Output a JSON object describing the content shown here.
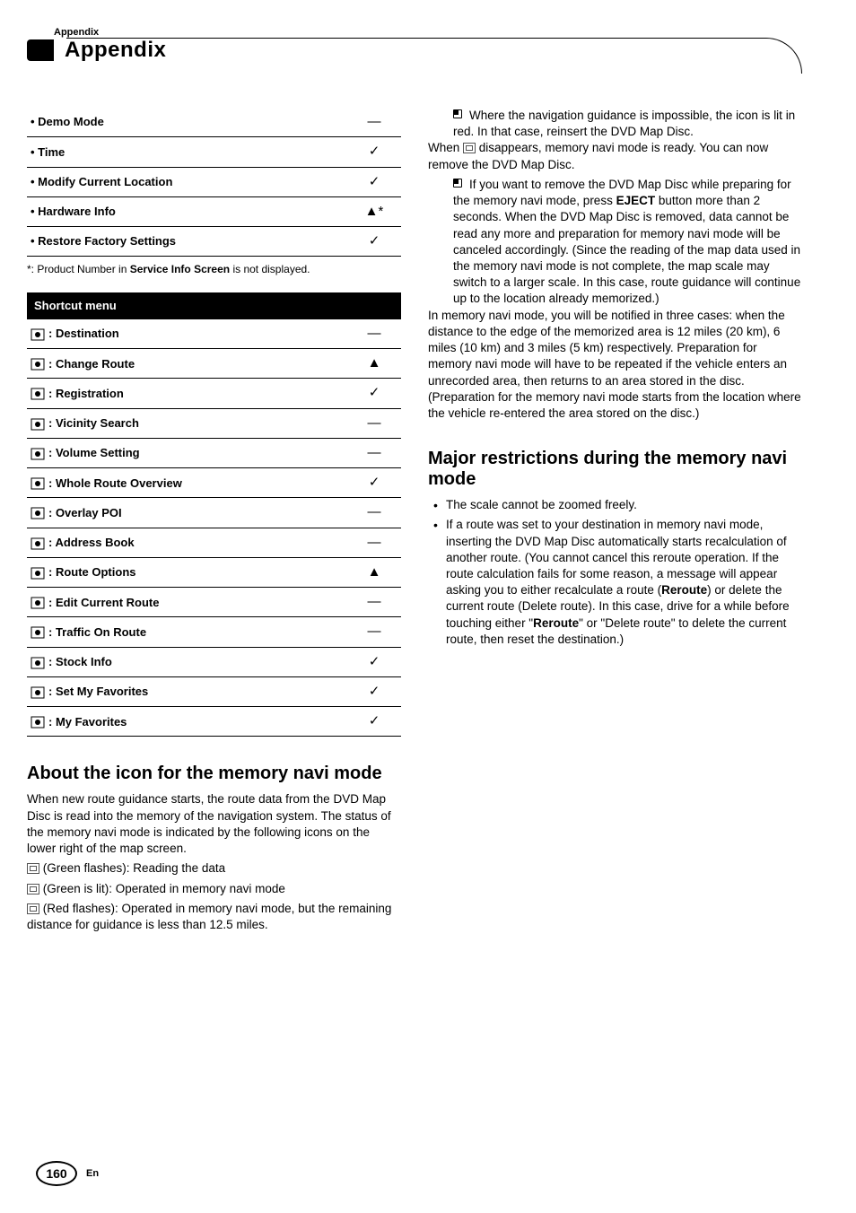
{
  "header": {
    "section_label": "Appendix",
    "chapter_title": "Appendix"
  },
  "table1": {
    "rows": [
      {
        "label": "• Demo Mode",
        "mark": "—"
      },
      {
        "label": "• Time",
        "mark": "✓"
      },
      {
        "label": "• Modify Current Location",
        "mark": "✓"
      },
      {
        "label": "• Hardware Info",
        "mark": "▲*"
      },
      {
        "label": "• Restore Factory Settings",
        "mark": "✓"
      }
    ],
    "footnote_a": "*: Product Number in ",
    "footnote_b": "Service Info Screen",
    "footnote_c": " is not displayed."
  },
  "shortcut": {
    "header": "Shortcut menu",
    "rows": [
      {
        "icon": "destination-icon",
        "label": ": Destination",
        "mark": "—"
      },
      {
        "icon": "change-route-icon",
        "label": ": Change Route",
        "mark": "▲"
      },
      {
        "icon": "registration-icon",
        "label": ": Registration",
        "mark": "✓"
      },
      {
        "icon": "vicinity-search-icon",
        "label": ": Vicinity Search",
        "mark": "—"
      },
      {
        "icon": "volume-setting-icon",
        "label": ": Volume Setting",
        "mark": "—"
      },
      {
        "icon": "whole-route-icon",
        "label": ": Whole Route Overview",
        "mark": "✓"
      },
      {
        "icon": "overlay-poi-icon",
        "label": ": Overlay POI",
        "mark": "—"
      },
      {
        "icon": "address-book-icon",
        "label": ": Address Book",
        "mark": "—"
      },
      {
        "icon": "route-options-icon",
        "label": ": Route Options",
        "mark": "▲"
      },
      {
        "icon": "edit-route-icon",
        "label": ": Edit Current Route",
        "mark": "—"
      },
      {
        "icon": "traffic-route-icon",
        "label": ": Traffic On Route",
        "mark": "—"
      },
      {
        "icon": "stock-info-icon",
        "label": ": Stock Info",
        "mark": "✓"
      },
      {
        "icon": "set-favorites-icon",
        "label": ": Set My Favorites",
        "mark": "✓"
      },
      {
        "icon": "my-favorites-icon",
        "label": ": My Favorites",
        "mark": "✓"
      }
    ]
  },
  "left_section": {
    "heading": "About the icon for the memory navi mode",
    "p1": "When new route guidance starts, the route data from the DVD Map Disc is read into the memory of the navigation system. The status of the memory navi mode is indicated by the following icons on the lower right of the map screen.",
    "l1": " (Green flashes): Reading the data",
    "l2": " (Green is lit): Operated in memory navi mode",
    "l3": " (Red flashes): Operated in memory navi mode, but the remaining distance for guidance is less than 12.5 miles."
  },
  "right": {
    "note1": "Where the navigation guidance is impossible, the icon is lit in red. In that case, reinsert the DVD Map Disc.",
    "p_when_a": "When ",
    "p_when_b": " disappears, memory navi mode is ready. You can now remove the DVD Map Disc.",
    "note2_a": "If you want to remove the DVD Map Disc while preparing for the memory navi mode, press ",
    "note2_eject": "EJECT",
    "note2_b": " button more than 2 seconds. When the DVD Map Disc is removed, data cannot be read any more and preparation for memory navi mode will be canceled accordingly. (Since the reading of the map data used in the memory navi mode is not complete, the map scale may switch to a larger scale. In this case, route guidance will continue up to the location already memorized.)",
    "p2": "In memory navi mode, you will be notified in three cases: when the distance to the edge of the memorized area is 12 miles (20 km), 6 miles (10 km) and 3 miles (5 km) respectively. Preparation for memory navi mode will have to be repeated if the vehicle enters an unrecorded area, then returns to an area stored in the disc. (Preparation for the memory navi mode starts from the location where the vehicle re-entered the area stored on the disc.)",
    "heading2": "Major restrictions during the memory navi mode",
    "b1": "The scale cannot be zoomed freely.",
    "b2_a": "If a route was set to your destination in memory navi mode, inserting the DVD Map Disc automatically starts recalculation of another route. (You cannot cancel this reroute operation. If the route calculation fails for some reason, a message will appear asking you to either recalculate a route (",
    "b2_reroute1": "Reroute",
    "b2_b": ") or delete the current route (Delete route). In this case, drive for a while before touching either \"",
    "b2_reroute2": "Reroute",
    "b2_c": "\" or \"Delete route\" to delete the current route, then reset the destination.)"
  },
  "footer": {
    "page": "160",
    "lang": "En"
  }
}
